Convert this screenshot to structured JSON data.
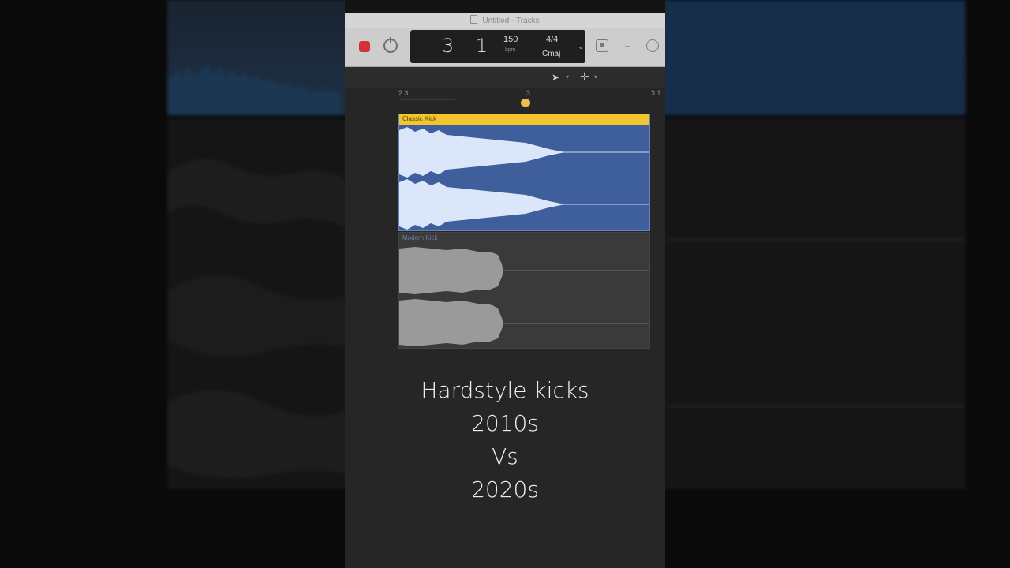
{
  "window": {
    "title": "Untitled - Tracks"
  },
  "transport": {
    "position": "3 1",
    "tempo": "150",
    "tempo_label": "bpm",
    "time_signature": "4/4",
    "key": "Cmaj"
  },
  "ruler": {
    "markers": [
      "2.3",
      "3",
      "3.1"
    ]
  },
  "regions": [
    {
      "name": "Classic Kick",
      "color": "#3f5f9c",
      "header_color": "#f2c62e"
    },
    {
      "name": "Modern Kick",
      "color": "#3a3a3a"
    }
  ],
  "caption": {
    "line1": "Hardstyle kicks",
    "line2": "2010s",
    "line3": "Vs",
    "line4": "2020s"
  },
  "icons": [
    "record-icon",
    "cycle-icon",
    "pointer-tool-icon",
    "crosshair-icon",
    "document-icon"
  ]
}
